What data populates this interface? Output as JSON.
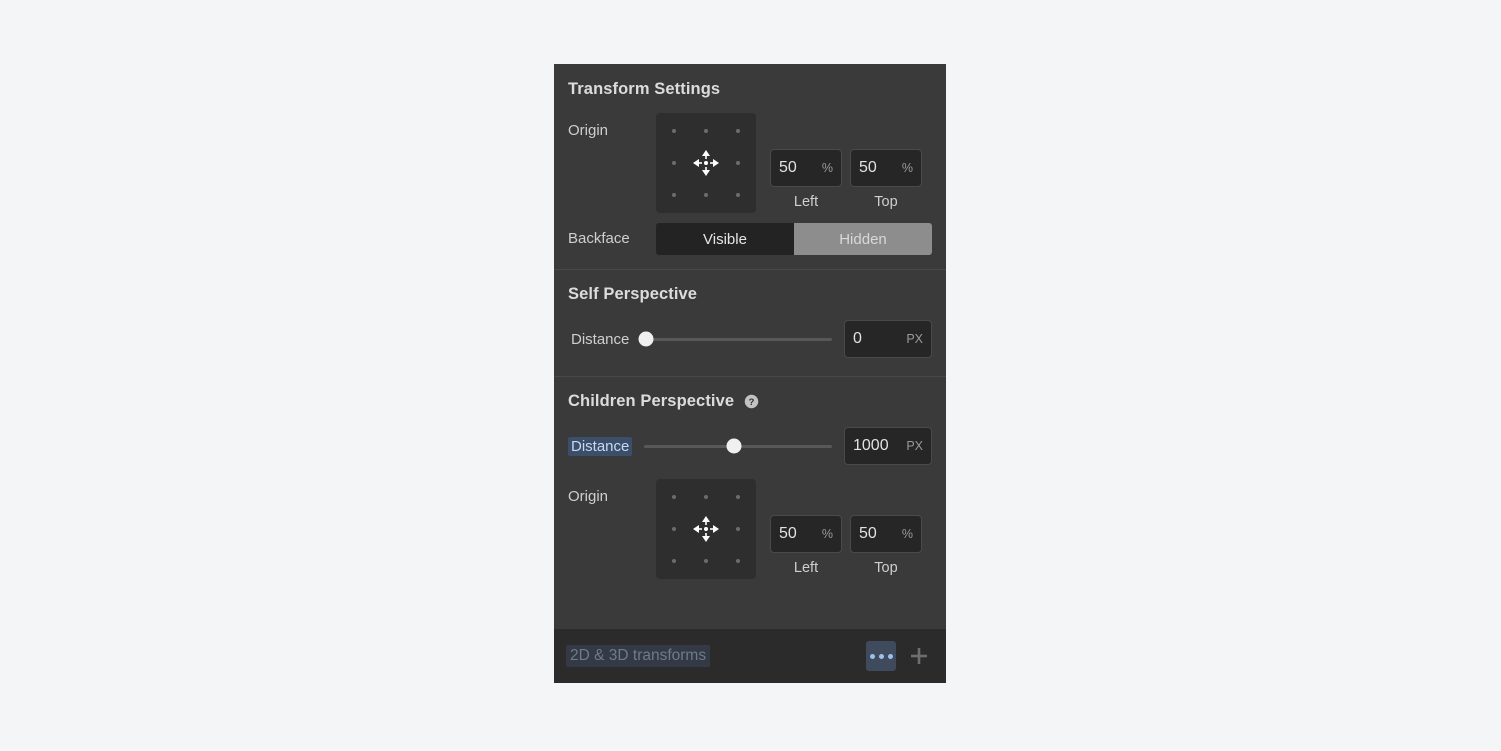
{
  "panel": {
    "sections": [
      {
        "title": "Transform Settings",
        "origin_label": "Origin",
        "origin_icon": "move-4-way-icon",
        "left": {
          "value": "50",
          "unit": "%",
          "caption": "Left"
        },
        "top": {
          "value": "50",
          "unit": "%",
          "caption": "Top"
        },
        "backface_label": "Backface",
        "backface_options": [
          "Visible",
          "Hidden"
        ],
        "backface_selected": "Hidden"
      },
      {
        "title": "Self Perspective",
        "distance_label": "Distance",
        "distance_value": "0",
        "distance_unit": "PX",
        "slider_percent": 1
      },
      {
        "title": "Children Perspective",
        "help_icon": "help-circle-icon",
        "distance_label": "Distance",
        "distance_value": "1000",
        "distance_unit": "PX",
        "slider_percent": 48,
        "distance_label_selected": true,
        "origin_label": "Origin",
        "origin_icon": "move-4-way-icon",
        "left": {
          "value": "50",
          "unit": "%",
          "caption": "Left"
        },
        "top": {
          "value": "50",
          "unit": "%",
          "caption": "Top"
        }
      }
    ],
    "footer": {
      "label": "2D & 3D transforms",
      "more_icon": "ellipsis-icon",
      "add_icon": "plus-icon"
    }
  },
  "colors": {
    "page_background": "#f4f5f6",
    "panel_background": "#3a3a3a",
    "footer_background": "#2b2b2b",
    "input_background": "#262626",
    "selection_blue": "#3b4f6b",
    "accent_blue": "#9cc0ee",
    "active_segment": "#8d8d8d"
  }
}
